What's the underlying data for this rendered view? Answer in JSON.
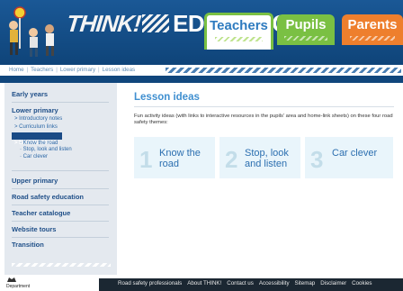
{
  "header": {
    "logo_think": "THINK!",
    "logo_education": "EDUCATION",
    "tabs": [
      {
        "label": "Teachers"
      },
      {
        "label": "Pupils"
      },
      {
        "label": "Parents"
      }
    ]
  },
  "breadcrumb": [
    "Home",
    "Teachers",
    "Lower primary",
    "Lesson ideas"
  ],
  "sidebar": {
    "early_years": "Early years",
    "lower_primary": "Lower primary",
    "introductory_notes": "> Introductory notes",
    "curriculum_links": "> Curriculum links",
    "lesson_ideas": "> Lesson ideas",
    "know_the_road": "· Know the road",
    "stop_look_listen": "· Stop, look and listen",
    "car_clever": "· Car clever",
    "upper_primary": "Upper primary",
    "road_safety_education": "Road safety education",
    "teacher_catalogue": "Teacher catalogue",
    "website_tours": "Website tours",
    "transition": "Transition"
  },
  "main": {
    "title": "Lesson ideas",
    "intro": "Fun activity ideas (with links to interactive resources in the pupils' area and home-link sheets) on these four road safety themes:",
    "cards": [
      {
        "num": "1",
        "text_line1": "Know the",
        "text_line2": "road"
      },
      {
        "num": "2",
        "text_line1": "Stop, look",
        "text_line2": "and listen"
      },
      {
        "num": "3",
        "text_line1": "Car clever",
        "text_line2": ""
      }
    ]
  },
  "footer": {
    "links": [
      "Road safety professionals",
      "About THINK!",
      "Contact us",
      "Accessibility",
      "Sitemap",
      "Disclaimer",
      "Cookies"
    ],
    "crest_text": "Department"
  },
  "colors": {
    "header_blue": "#10467c",
    "teachers_green": "#7ac043",
    "parents_orange": "#ee7f2d",
    "title_blue": "#3f8fd0",
    "footer_dark": "#1b2732"
  }
}
